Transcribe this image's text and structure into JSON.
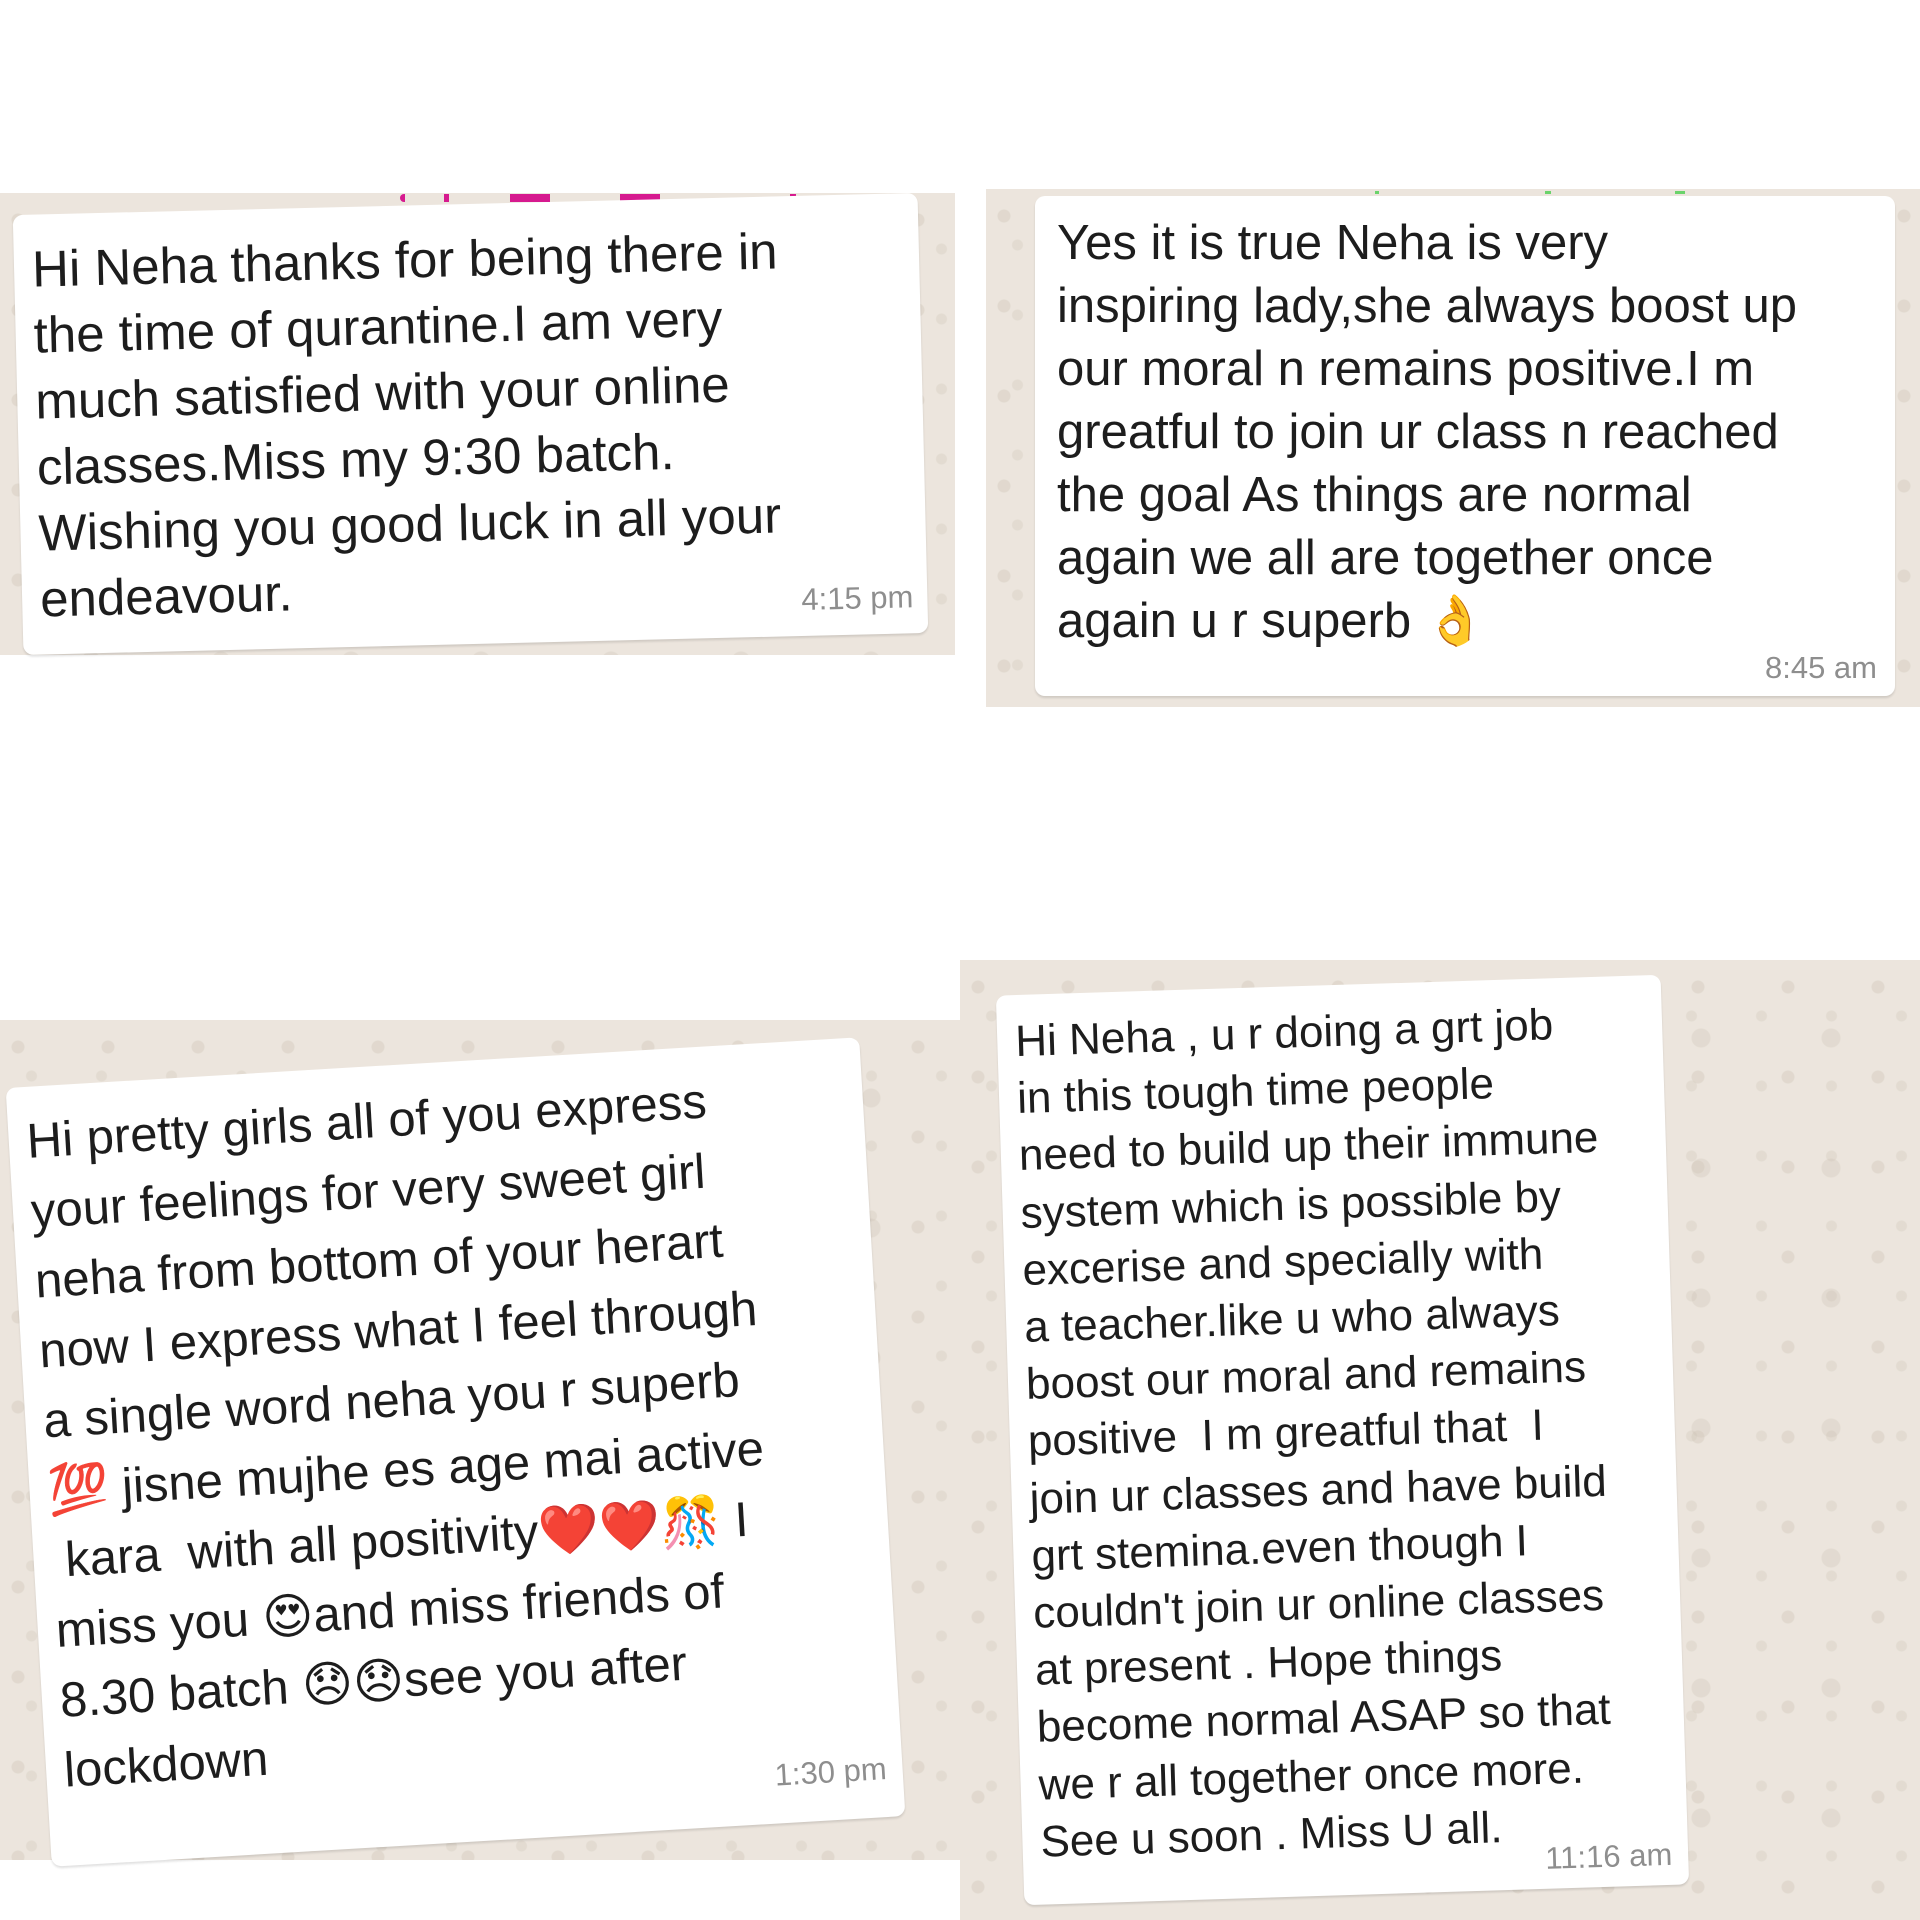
{
  "messages": [
    {
      "text": "Hi Neha thanks for being there in\nthe time of qurantine.I am very\nmuch satisfied with your online\nclasses.Miss my 9:30 batch.\nWishing you good luck in all your\nendeavour.",
      "time": "4:15 pm"
    },
    {
      "text": "Yes it is true Neha is very\ninspiring lady,she always boost up\nour moral n remains positive.I m\ngreatful to join ur class n reached\nthe goal As things are normal\nagain we all are together once\nagain u r superb 👌",
      "time": "8:45 am"
    },
    {
      "text": "Hi pretty girls all of you express\nyour feelings for very sweet girl\nneha from bottom of your herart\nnow I express what I feel through\na single word neha you r superb\n💯 jisne mujhe es age mai active\n kara  with all positivity❤️❤️🎊 I\nmiss you 😍and miss friends of\n8.30 batch 😞😞see you after\nlockdown",
      "time": "1:30 pm"
    },
    {
      "text": "Hi Neha , u r doing a grt job\nin this tough time people\nneed to build up their immune\nsystem which is possible by\nexcerise and specially with\na teacher.like u who always\nboost our moral and remains\npositive  I m greatful that  I\njoin ur classes and have build\ngrt stemina.even though I\ncouldn't join ur online classes\nat present . Hope things\nbecome normal ASAP so that\nwe r all together once more.\nSee u soon . Miss U all.",
      "time": "11:16 am"
    }
  ],
  "colors": {
    "chat_bg": "#ece5dd",
    "bubble_bg": "#ffffff",
    "timestamp": "#8e8e8e",
    "text": "#1d1d1d"
  }
}
